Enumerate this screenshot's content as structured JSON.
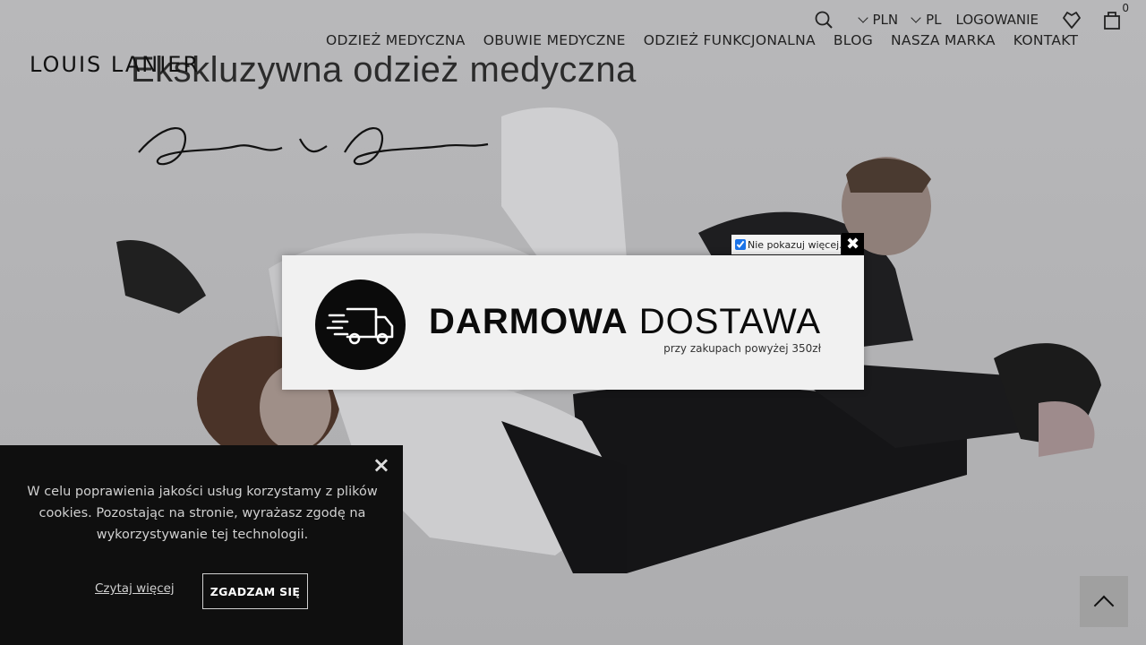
{
  "header": {
    "logo": "LOUIS LANIER",
    "currency": "PLN",
    "language": "PL",
    "login": "LOGOWANIE",
    "cart_count": "0"
  },
  "nav": {
    "items": [
      "ODZIEŻ MEDYCZNA",
      "OBUWIE MEDYCZNE",
      "ODZIEŻ FUNKCJONALNA",
      "BLOG",
      "NASZA MARKA",
      "KONTAKT"
    ]
  },
  "hero": {
    "title": "Ekskluzywna odzież medyczna",
    "signature": "Louis Lanier"
  },
  "modal": {
    "dont_show_label": "Nie pokazuj więcej.",
    "dont_show_checked": true,
    "heading_bold": "DARMOWA",
    "heading_light": "DOSTAWA",
    "subtext": "przy zakupach powyżej 350zł",
    "close_icon": "close-icon"
  },
  "cookie": {
    "text": "W celu poprawienia jakości usług korzystamy z plików cookies. Pozostając na stronie, wyrażasz zgodę na wykorzystywanie tej technologii.",
    "read_more": "Czytaj więcej",
    "accept": "ZGADZAM SIĘ"
  },
  "colors": {
    "overlay_bg": "#b3b3b5",
    "modal_bg": "#f1f1f1",
    "cookie_bg": "#0f0f0f",
    "text_dark": "#0b0b0b"
  }
}
